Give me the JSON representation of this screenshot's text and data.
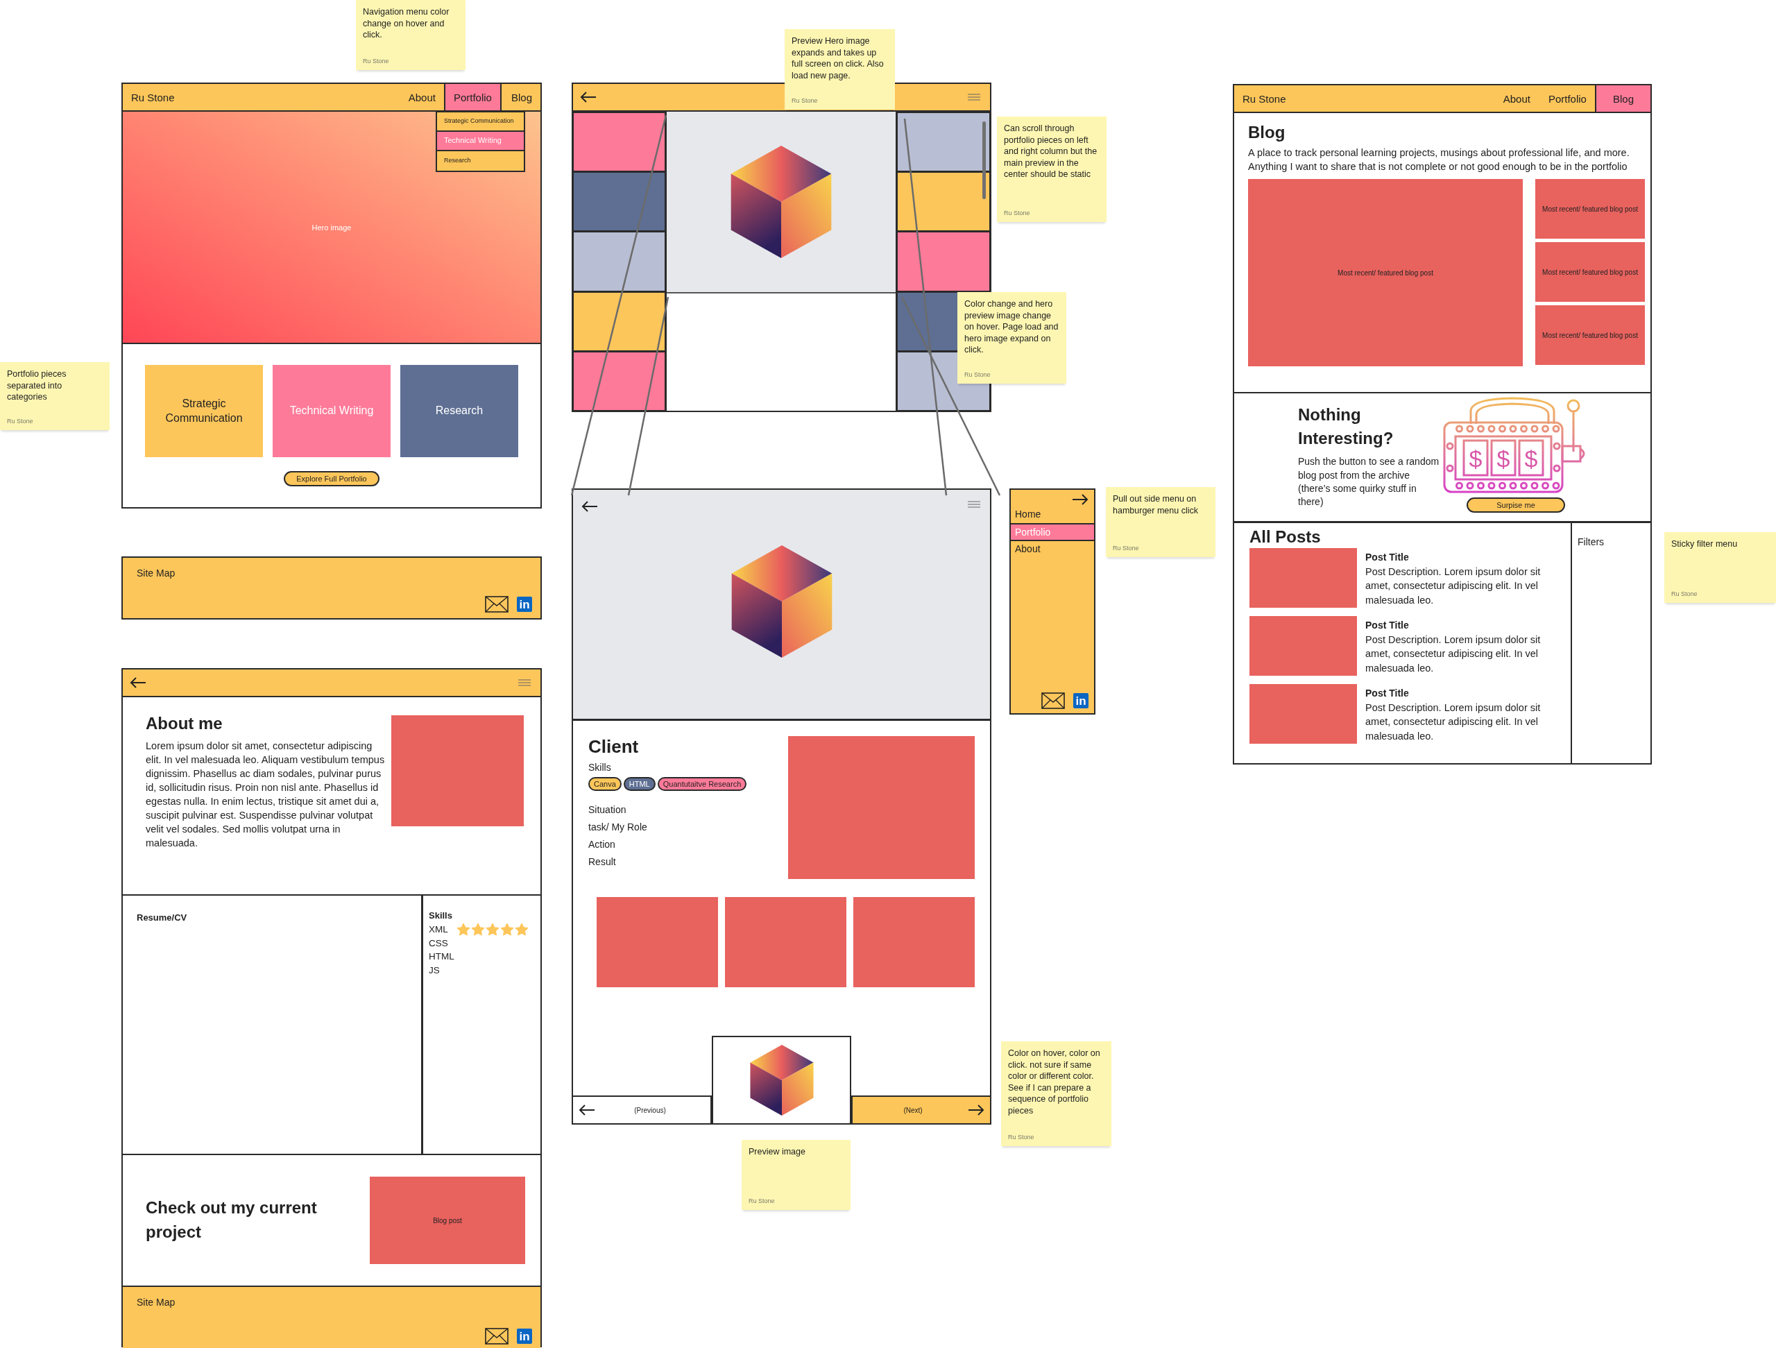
{
  "stickies": [
    {
      "text": "Navigation menu color change on hover and click.",
      "author": "Ru Stone"
    },
    {
      "text": "Preview Hero image expands and takes up full screen on click. Also load new page.",
      "author": "Ru Stone"
    },
    {
      "text": "Can scroll through portfolio pieces on left and right column but the main preview in the center should be static",
      "author": "Ru Stone"
    },
    {
      "text": "Color change and hero preview image change on hover. Page load and hero image expand on click.",
      "author": "Ru Stone"
    },
    {
      "text": "Portfolio pieces separated into categories",
      "author": "Ru Stone"
    },
    {
      "text": "Pull out side menu on hamburger menu click",
      "author": "Ru Stone"
    },
    {
      "text": "Sticky filter menu",
      "author": "Ru Stone"
    },
    {
      "text": "Color on hover, color on click. not sure if same color or different color. See if I can prepare a sequence of portfolio pieces",
      "author": "Ru Stone"
    },
    {
      "text": "Preview image",
      "author": "Ru Stone"
    }
  ],
  "home_page": {
    "brand": "Ru Stone",
    "nav": [
      {
        "label": "About",
        "selected": false
      },
      {
        "label": "Portfolio",
        "selected": true
      },
      {
        "label": "Blog",
        "selected": false
      }
    ],
    "dropdown": [
      {
        "label": "Strategic Communication",
        "selected": false
      },
      {
        "label": "Technical Writing",
        "selected": true
      },
      {
        "label": "Research",
        "selected": false
      }
    ],
    "hero": "Hero image",
    "categories": [
      {
        "label": "Strategic Communication",
        "color": "#fdc65a"
      },
      {
        "label": "Technical Writing",
        "color": "#fe7a99"
      },
      {
        "label": "Research",
        "color": "#5e6f93"
      }
    ],
    "button": "Explore Full Portfolio"
  },
  "home_footer": {
    "label": "Site Map",
    "social": "in"
  },
  "about_page": {
    "title": "About me",
    "body": "Lorem ipsum dolor sit amet, consectetur adipiscing elit. In vel malesuada leo. Aliquam vestibulum tempus dignissim. Phasellus ac diam sodales, pulvinar purus id, sollicitudin risus. Proin non nisl ante. Phasellus id egestas nulla. In enim lectus, tristique sit amet dui a, suscipit pulvinar est. Suspendisse pulvinar volutpat velit vel sodales. Sed mollis volutpat urna in malesuada.",
    "resume": "Resume/CV",
    "skills_title": "Skills",
    "skills": [
      {
        "name": "XML",
        "stars": 5
      },
      {
        "name": "CSS"
      },
      {
        "name": "HTML"
      },
      {
        "name": "JS"
      }
    ],
    "project_title": "Check out my current project",
    "project_card": "Blog post",
    "footer": {
      "label": "Site Map",
      "social": "in"
    }
  },
  "gallery_page": {
    "left_tiles": [
      {
        "color": "#fe7a99"
      },
      {
        "color": "#5e6f93"
      },
      {
        "color": "#b8bed3"
      },
      {
        "color": "#fdc65a"
      },
      {
        "color": "#fe7a99"
      }
    ],
    "right_tiles": [
      {
        "color": "#b8bed3"
      },
      {
        "color": "#fdc65a"
      },
      {
        "color": "#fe7a99"
      },
      {
        "color": "#5e6f93"
      },
      {
        "color": "#b8bed3"
      }
    ]
  },
  "detail_page": {
    "title": "Client",
    "skills_label": "Skills",
    "tags": [
      {
        "label": "Canva",
        "color": "#fdc65a"
      },
      {
        "label": "HTML",
        "color": "#5e6f93"
      },
      {
        "label": "Quantutaitve Research",
        "color": "#fe7a99"
      }
    ],
    "sections": [
      "Situation",
      "task/ My Role",
      "Action",
      "Result"
    ],
    "previous": "(Previous)",
    "next": "(Next)"
  },
  "side_menu": {
    "items": [
      {
        "label": "Home",
        "selected": false
      },
      {
        "label": "Portfolio",
        "selected": true
      },
      {
        "label": "About",
        "selected": false
      }
    ],
    "social": "in"
  },
  "blog_page": {
    "brand": "Ru Stone",
    "nav": [
      {
        "label": "About",
        "selected": false
      },
      {
        "label": "Portfolio",
        "selected": false
      },
      {
        "label": "Blog",
        "selected": true
      }
    ],
    "title": "Blog",
    "intro": "A place to track personal learning projects, musings about professional life, and more. Anything I want to share that is not complete or not good enough to be in the portfolio",
    "featured": "Most recent/ featured blog post",
    "side_featured": [
      "Most recent/ featured blog post",
      "Most recent/ featured blog post",
      "Most recent/ featured blog post"
    ],
    "nothing_title": "Nothing Interesting?",
    "nothing_text": "Push the button to see a random blog post from the archive (there’s some quirky stuff in there)",
    "slot_symbols": [
      "$",
      "$",
      "$"
    ],
    "surprise_button": "Surpise me",
    "all_posts": "All Posts",
    "filters": "Filters",
    "posts": [
      {
        "title": "Post Title",
        "description": "Post Description. Lorem ipsum dolor sit amet, consectetur adipiscing elit. In vel malesuada leo."
      },
      {
        "title": "Post Title",
        "description": "Post Description. Lorem ipsum dolor sit amet, consectetur adipiscing elit. In vel malesuada leo."
      },
      {
        "title": "Post Title",
        "description": "Post Description. Lorem ipsum dolor sit amet, consectetur adipiscing elit. In vel malesuada leo."
      }
    ]
  }
}
